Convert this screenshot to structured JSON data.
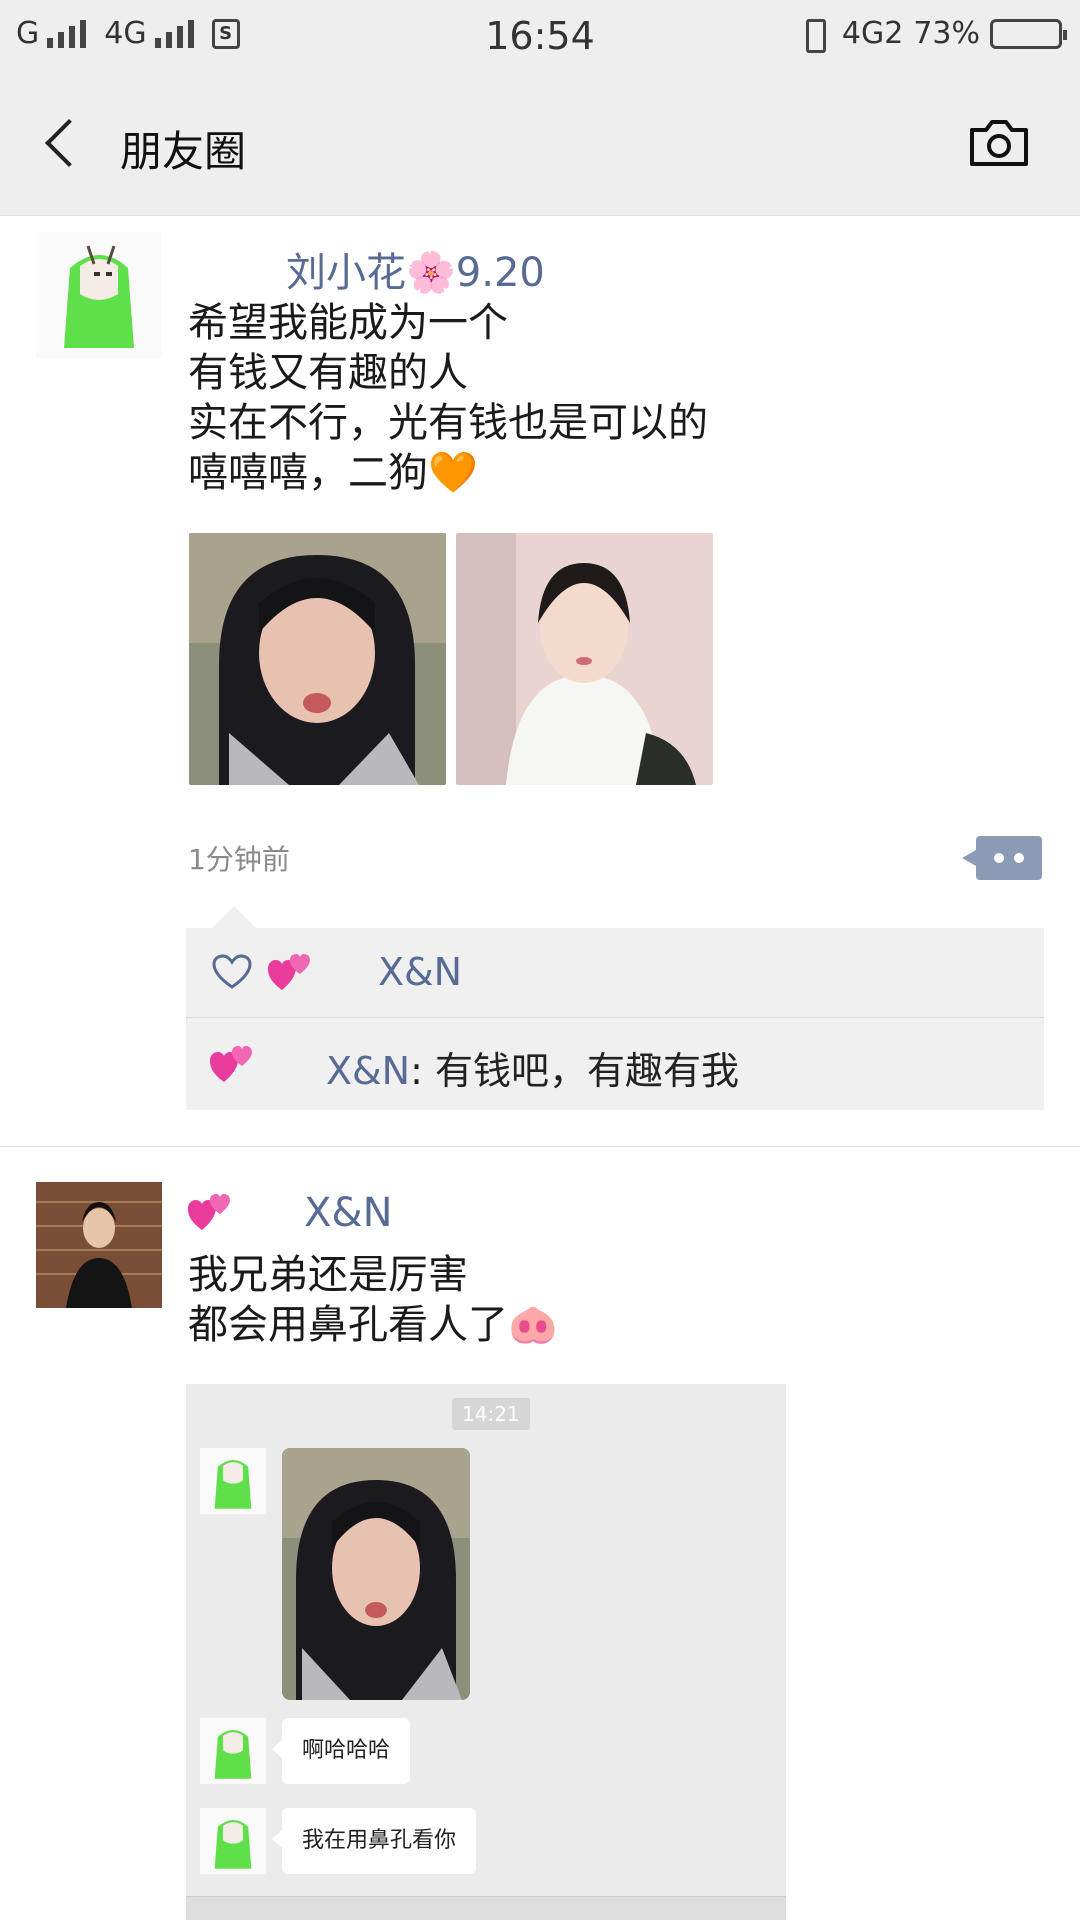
{
  "status_bar": {
    "carrier": "G",
    "network": "4G",
    "sim_label": "S",
    "time": "16:54",
    "network_right": "4G2",
    "battery_percent": "73%",
    "battery_level": 0.73
  },
  "nav": {
    "title": "朋友圈",
    "back_icon": "chevron-left-icon",
    "camera_icon": "camera-icon"
  },
  "posts": [
    {
      "author": "刘小花🌸9.20",
      "text": "希望我能成为一个\n有钱又有趣的人\n实在不行，光有钱也是可以的\n嘻嘻嘻，二狗🧡",
      "time": "1分钟前",
      "likes": [
        "X&N"
      ],
      "comments": [
        {
          "user": "X&N",
          "separator": ": ",
          "text": "有钱吧，有趣有我"
        }
      ]
    },
    {
      "author": "X&N",
      "text": "我兄弟还是厉害\n都会用鼻孔看人了🐽",
      "chat": {
        "time": "14:21",
        "messages": [
          "啊哈哈哈",
          "我在用鼻孔看你"
        ]
      }
    }
  ],
  "colors": {
    "link": "#576b95",
    "bar_bg": "#eeeeee",
    "comment_bg": "#f0f0f0",
    "more_button": "#8b9ab5"
  }
}
